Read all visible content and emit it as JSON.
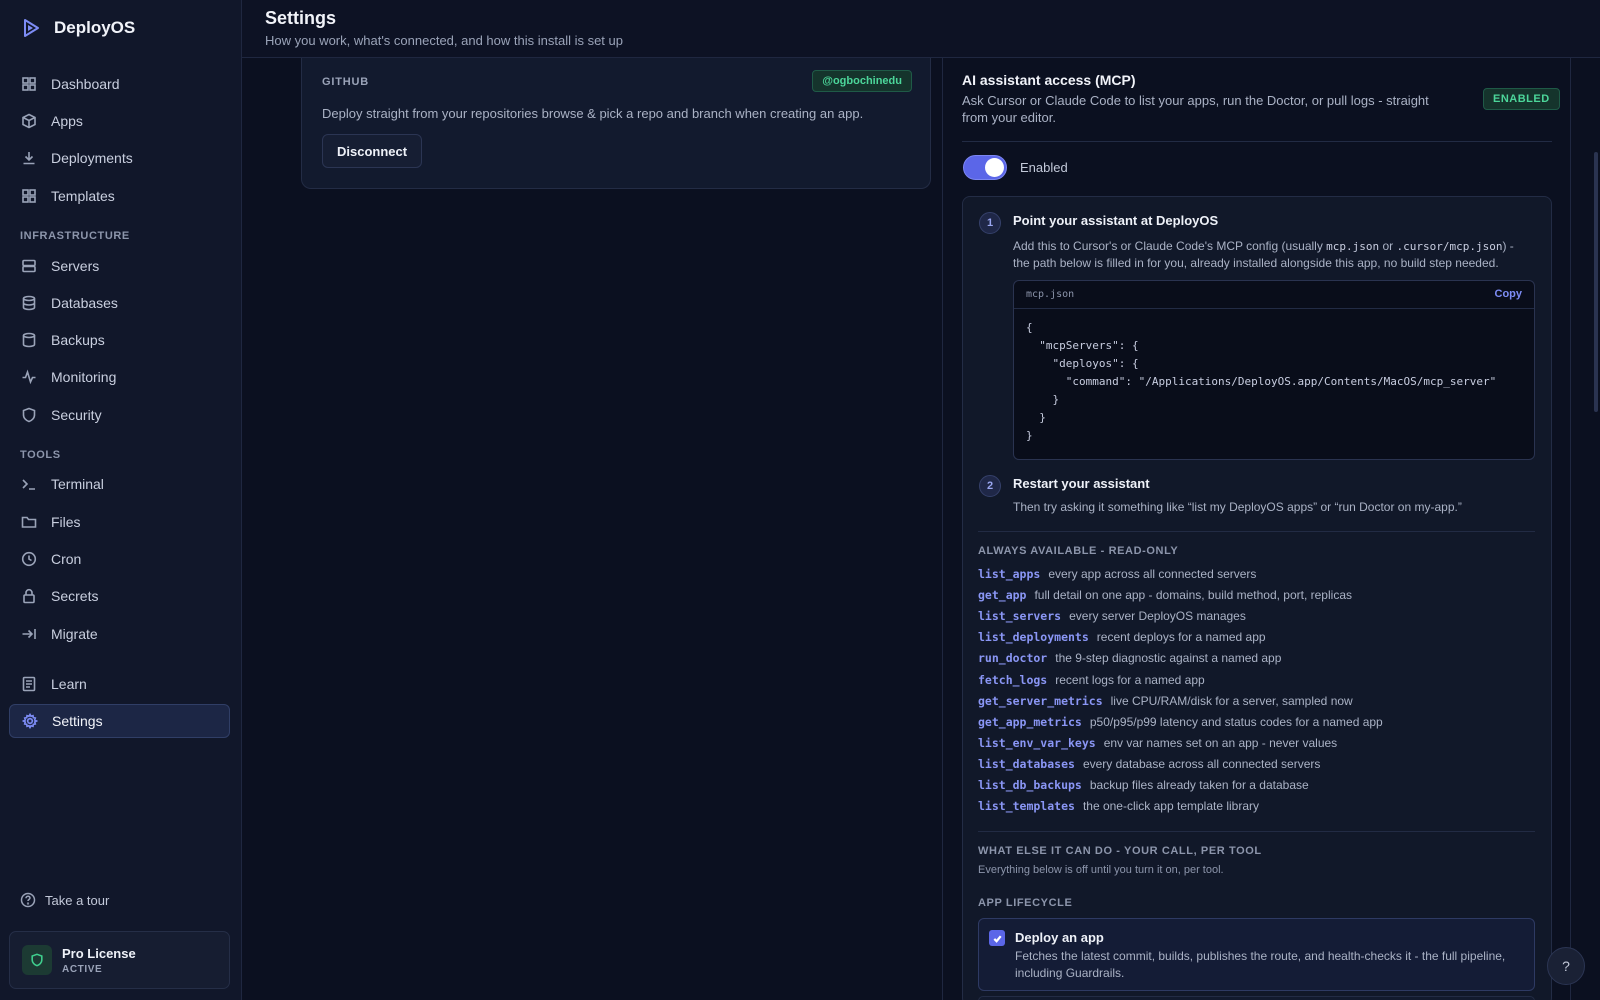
{
  "brand": {
    "name": "DeployOS"
  },
  "sidebar": {
    "main": [
      {
        "label": "Dashboard",
        "icon": "dashboard-icon"
      },
      {
        "label": "Apps",
        "icon": "box-icon"
      },
      {
        "label": "Deployments",
        "icon": "download-icon"
      },
      {
        "label": "Templates",
        "icon": "grid-icon"
      }
    ],
    "infrastructure_label": "INFRASTRUCTURE",
    "infrastructure": [
      {
        "label": "Servers",
        "icon": "server-icon"
      },
      {
        "label": "Databases",
        "icon": "database-icon"
      },
      {
        "label": "Backups",
        "icon": "backup-icon"
      },
      {
        "label": "Monitoring",
        "icon": "pulse-icon"
      },
      {
        "label": "Security",
        "icon": "shield-icon"
      }
    ],
    "tools_label": "TOOLS",
    "tools": [
      {
        "label": "Terminal",
        "icon": "terminal-icon"
      },
      {
        "label": "Files",
        "icon": "folder-icon"
      },
      {
        "label": "Cron",
        "icon": "clock-icon"
      },
      {
        "label": "Secrets",
        "icon": "lock-icon"
      },
      {
        "label": "Migrate",
        "icon": "migrate-icon"
      }
    ],
    "bottom": [
      {
        "label": "Learn",
        "icon": "book-icon"
      },
      {
        "label": "Settings",
        "icon": "gear-icon",
        "active": true
      }
    ],
    "tour_label": "Take a tour",
    "license": {
      "title": "Pro License",
      "status": "ACTIVE"
    }
  },
  "header": {
    "title": "Settings",
    "subtitle": "How you work, what's connected, and how this install is set up"
  },
  "github": {
    "label": "GITHUB",
    "handle": "@ogbochinedu",
    "description": "Deploy straight from your repositories browse & pick a repo and branch when creating an app.",
    "disconnect_label": "Disconnect"
  },
  "mcp": {
    "title": "AI assistant access (MCP)",
    "description": "Ask Cursor or Claude Code to list your apps, run the Doctor, or pull logs - straight from your editor.",
    "badge": "ENABLED",
    "toggle_label": "Enabled",
    "toggle_on": true,
    "step1": {
      "number": "1",
      "title": "Point your assistant at DeployOS",
      "text_before": "Add this to Cursor's or Claude Code's MCP config (usually ",
      "code1": "mcp.json",
      "text_mid": " or ",
      "code2": ".cursor/mcp.json",
      "text_after": ") - the path below is filled in for you, already installed alongside this app, no build step needed."
    },
    "code": {
      "filename": "mcp.json",
      "copy_label": "Copy",
      "content": "{\n  \"mcpServers\": {\n    \"deployos\": {\n      \"command\": \"/Applications/DeployOS.app/Contents/MacOS/mcp_server\"\n    }\n  }\n}"
    },
    "step2": {
      "number": "2",
      "title": "Restart your assistant",
      "text": "Then try asking it something like “list my DeployOS apps” or “run Doctor on my-app.”"
    },
    "readonly_label": "ALWAYS AVAILABLE - READ-ONLY",
    "tools": [
      {
        "name": "list_apps",
        "desc": "every app across all connected servers"
      },
      {
        "name": "get_app",
        "desc": "full detail on one app - domains, build method, port, replicas"
      },
      {
        "name": "list_servers",
        "desc": "every server DeployOS manages"
      },
      {
        "name": "list_deployments",
        "desc": "recent deploys for a named app"
      },
      {
        "name": "run_doctor",
        "desc": "the 9-step diagnostic against a named app"
      },
      {
        "name": "fetch_logs",
        "desc": "recent logs for a named app"
      },
      {
        "name": "get_server_metrics",
        "desc": "live CPU/RAM/disk for a server, sampled now"
      },
      {
        "name": "get_app_metrics",
        "desc": "p50/p95/p99 latency and status codes for a named app"
      },
      {
        "name": "list_env_var_keys",
        "desc": "env var names set on an app - never values"
      },
      {
        "name": "list_databases",
        "desc": "every database across all connected servers"
      },
      {
        "name": "list_db_backups",
        "desc": "backup files already taken for a database"
      },
      {
        "name": "list_templates",
        "desc": "the one-click app template library"
      }
    ],
    "optin_label": "WHAT ELSE IT CAN DO - YOUR CALL, PER TOOL",
    "optin_note": "Everything below is off until you turn it on, per tool.",
    "lifecycle_label": "APP LIFECYCLE",
    "deploy": {
      "title": "Deploy an app",
      "description": "Fetches the latest commit, builds, publishes the route, and health-checks it - the full pipeline, including Guardrails.",
      "checked": true
    }
  },
  "help": {
    "label": "?"
  },
  "colors": {
    "accent": "#5b66e8",
    "success": "#4cd69a",
    "background": "#0b1020"
  }
}
